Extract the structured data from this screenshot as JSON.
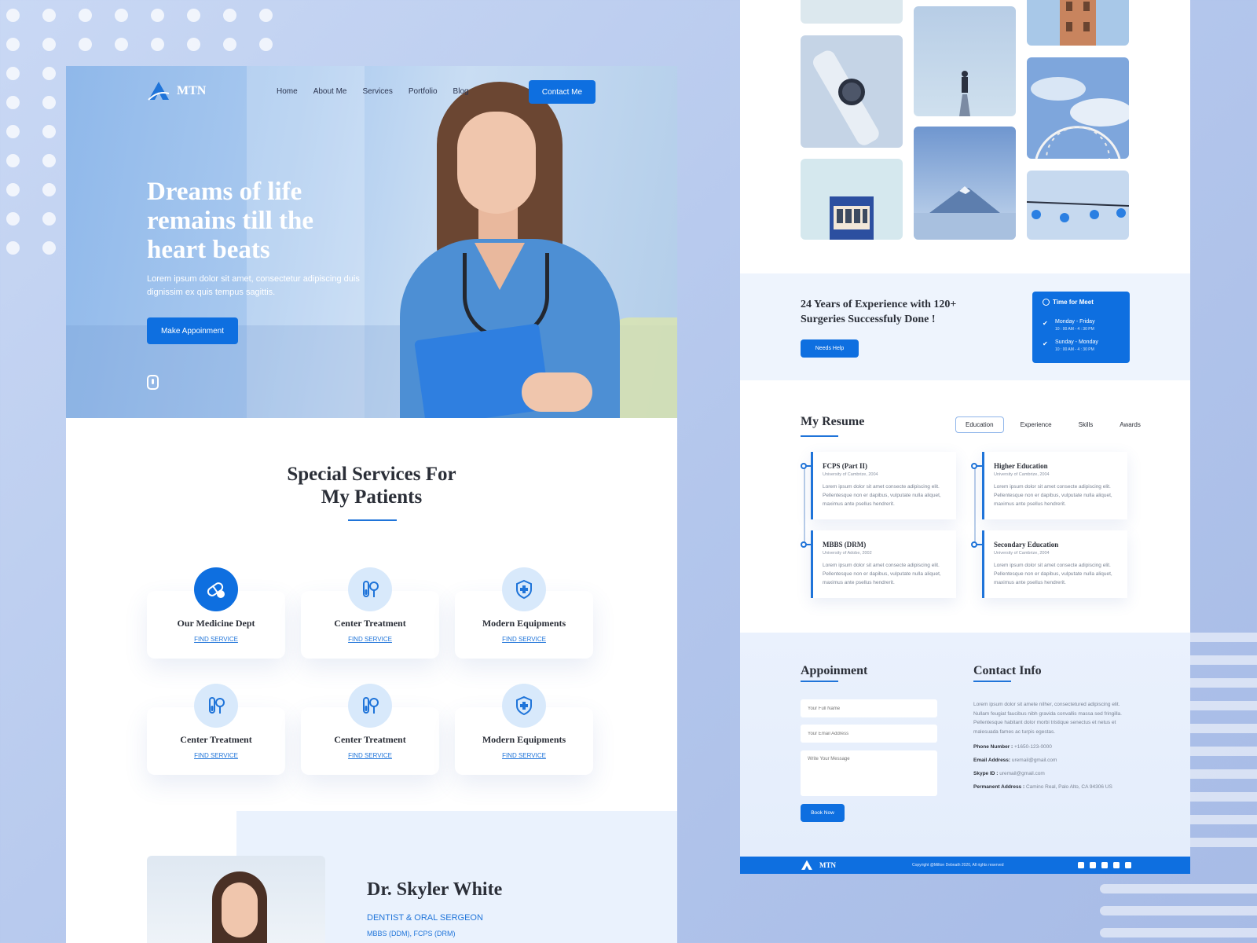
{
  "brand": {
    "name": "MTN"
  },
  "nav": {
    "items": [
      "Home",
      "About Me",
      "Services",
      "Portfolio",
      "Blog"
    ],
    "cta": "Contact Me"
  },
  "hero": {
    "title": "Dreams of life remains till the heart beats",
    "subtitle": "Lorem ipsum dolor sit amet, consectetur adipiscing duis dignissim ex quis tempus sagittis.",
    "button": "Make Appoinment"
  },
  "services": {
    "title": "Special Services For My Patients",
    "items": [
      {
        "title": "Our Medicine Dept",
        "link": "FIND SERVICE",
        "icon": "pills-icon",
        "active": true
      },
      {
        "title": "Center Treatment",
        "link": "FIND SERVICE",
        "icon": "test-tubes-icon",
        "active": false
      },
      {
        "title": "Modern Equipments",
        "link": "FIND SERVICE",
        "icon": "shield-plus-icon",
        "active": false
      },
      {
        "title": "Center Treatment",
        "link": "FIND SERVICE",
        "icon": "test-tubes-icon",
        "active": false
      },
      {
        "title": "Center Treatment",
        "link": "FIND SERVICE",
        "icon": "test-tubes-icon",
        "active": false
      },
      {
        "title": "Modern Equipments",
        "link": "FIND SERVICE",
        "icon": "shield-plus-icon",
        "active": false
      }
    ]
  },
  "about": {
    "name": "Dr. Skyler White",
    "role": "DENTIST & ORAL SERGEON",
    "degrees": "MBBS (DDM), FCPS (DRM)"
  },
  "experience": {
    "title": "24 Years of Experience with 120+ Surgeries Successfuly Done !",
    "button": "Needs Help",
    "schedule_title": "Time for Meet",
    "schedule": [
      {
        "days": "Monday - Friday",
        "time": "10 : 00 AM - 4 : 30 PM"
      },
      {
        "days": "Sunday - Monday",
        "time": "10 : 00 AM - 4 : 30 PM"
      }
    ]
  },
  "resume": {
    "title": "My Resume",
    "tabs": [
      "Education",
      "Experience",
      "Skills",
      "Awards"
    ],
    "active_tab": "Education",
    "entries": [
      {
        "title": "FCPS (Part II)",
        "place": "University of Cambrize, 2004",
        "text": "Lorem ipsum dolor sit amet consecte adipiscing elit. Pellentesque non er dapibus, vulputate nulla aliquet, maximus ante psellus hendrerit."
      },
      {
        "title": "Higher Education",
        "place": "University of Cambrize, 2004",
        "text": "Lorem ipsum dolor sit amet consecte adipiscing elit. Pellentesque non er dapibus, vulputate nulla aliquet, maximus ante psellus hendrerit."
      },
      {
        "title": "MBBS (DRM)",
        "place": "University of Adobe, 2002",
        "text": "Lorem ipsum dolor sit amet consecte adipiscing elit. Pellentesque non er dapibus, vulputate nulla aliquet, maximus ante psellus hendrerit."
      },
      {
        "title": "Secondary Education",
        "place": "University of Cambrize, 2004",
        "text": "Lorem ipsum dolor sit amet consecte adipiscing elit. Pellentesque non er dapibus, vulputate nulla aliquet, maximus ante psellus hendrerit."
      }
    ]
  },
  "appointment": {
    "title": "Appoinment",
    "name_placeholder": "Your Full Name",
    "email_placeholder": "Your Email Address",
    "message_placeholder": "Write Your Message",
    "button": "Book Now"
  },
  "contact": {
    "title": "Contact Info",
    "text": "Lorem ipsum dolor sit amete nilher, consectetured adipiscing elit. Nullam feugiat faucibus nibh gravida convallis massa sed fringilla. Pellentesque habitant dolor morbi tristique senectus et netus et malesuada fames ac turpis egestas.",
    "phone_label": "Phone Number :",
    "phone": "+1650-123-0000",
    "email_label": "Email Address:",
    "email": "uremail@gmail.com",
    "skype_label": "Skype ID :",
    "skype": "uremail@gmail.com",
    "address_label": "Permanent Address :",
    "address": "Camino Real, Palo Alto, CA 94306 US"
  },
  "footer": {
    "copyright": "Copyright @Milton Debnath 2020, All rights reserved",
    "socials": [
      "facebook-icon",
      "twitter-icon",
      "instagram-icon",
      "linkedin-icon",
      "vimeo-icon"
    ]
  },
  "colors": {
    "primary": "#0e6fe0",
    "light": "#d8e9fb",
    "band": "#eef4fd"
  }
}
